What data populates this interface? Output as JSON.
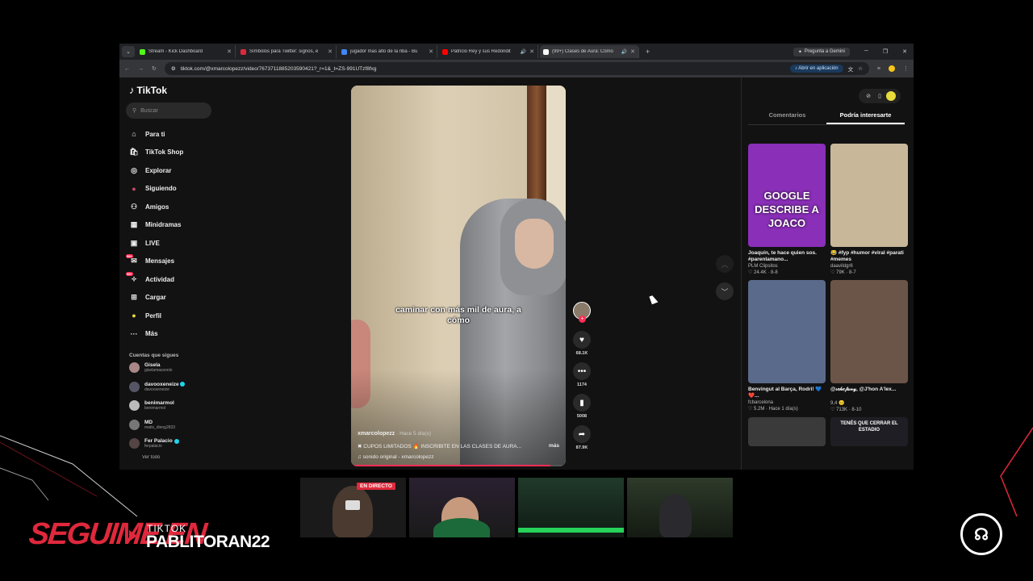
{
  "browser": {
    "tabs": [
      {
        "title": "Stream - Kick Dashboard",
        "fav_color": "#53fc18",
        "active": false,
        "audio": false
      },
      {
        "title": "Símbolos para Twitter: signos, e",
        "fav_color": "#e0283c",
        "active": false,
        "audio": false
      },
      {
        "title": "jugador mas alto de la nba - Bu",
        "fav_color": "#4285f4",
        "active": false,
        "audio": false
      },
      {
        "title": "Patricio Rey y sus Redondit",
        "fav_color": "#ff0000",
        "active": false,
        "audio": true
      },
      {
        "title": "(99+) Clases de Aura: Cómo",
        "fav_color": "#ffffff",
        "active": true,
        "audio": true
      }
    ],
    "new_tab": "+",
    "gemini_label": "Pregunta a Gemini",
    "url": "tiktok.com/@xmarcolopezz/video/7673711885203590421?_r=1&_t=ZS-991UTzf8fxg",
    "open_app_label": "Abrir en aplicación"
  },
  "tiktok": {
    "logo": "TikTok",
    "search_placeholder": "Buscar",
    "nav": [
      {
        "label": "Para ti",
        "icon": "home-icon"
      },
      {
        "label": "TikTok Shop",
        "icon": "shop-icon"
      },
      {
        "label": "Explorar",
        "icon": "compass-icon"
      },
      {
        "label": "Siguiendo",
        "icon": "following-icon"
      },
      {
        "label": "Amigos",
        "icon": "friends-icon"
      },
      {
        "label": "Minidramas",
        "icon": "minidramas-icon"
      },
      {
        "label": "LIVE",
        "icon": "live-icon"
      },
      {
        "label": "Mensajes",
        "icon": "messages-icon",
        "badge": "99+"
      },
      {
        "label": "Actividad",
        "icon": "activity-icon",
        "badge": "99+"
      },
      {
        "label": "Cargar",
        "icon": "upload-icon"
      },
      {
        "label": "Perfil",
        "icon": "profile-icon"
      },
      {
        "label": "Más",
        "icon": "more-icon"
      }
    ],
    "following_title": "Cuentas que sigues",
    "following": [
      {
        "name": "Gisela",
        "handle": "giselamassonlo",
        "verified": false
      },
      {
        "name": "davooxeneize",
        "handle": "davooxeneize",
        "verified": true
      },
      {
        "name": "benimarmol",
        "handle": "benimarmol",
        "verified": false
      },
      {
        "name": "MD",
        "handle": "matis_dieng2833",
        "verified": false
      },
      {
        "name": "Fer Palacio",
        "handle": "ferpalacio",
        "verified": true
      }
    ],
    "see_all": "Ver todo"
  },
  "video": {
    "caption": "caminar con más mil de aura, a cómo",
    "author": "xmarcolopezz",
    "time": "· Hace 5 día(s)",
    "description": "✖ CUPOS LIMITADOS 🔥 INSCRIBITE EN LAS CLASES DE AURA...",
    "more": "más",
    "sound": "♫  sonido original - xmarcolopezz",
    "progress": 0.93,
    "likes": "68.1K",
    "comments": "1174",
    "saves": "5008",
    "shares": "87.9K"
  },
  "right_panel": {
    "tabs": [
      "Comentarios",
      "Podría interesarte"
    ],
    "active_tab": 1,
    "cards": [
      {
        "title": "Joaquín, te hace quien sos. #parenlamano...",
        "author": "PLM Clipsitos",
        "stats": "♡ 24.4K · 8-8",
        "thumb_text": "GOOGLE DESCRIBE A JOACO",
        "bg": "#8a2fb8"
      },
      {
        "title": "😂 #fyp #humor #viral #parati #memes",
        "author": "daavildgr6",
        "stats": "♡ 79K · 8-7",
        "thumb_text": "",
        "bg": "#c9b79a"
      },
      {
        "title": "Benvingut al Barça, Rodri! 💙❤️...",
        "author": "fcbarcelona",
        "stats": "♡ 5.2M · Hace 1 día(s)",
        "thumb_text": "",
        "bg": "#5a6a8a"
      },
      {
        "title": "@𝓈𝑒𝒽𝑒𝒻𝒶𝓃𝓎, @J'hon A'lex...",
        "author": "9,4 😐",
        "stats": "♡ 713K · 8-10",
        "thumb_text": "",
        "bg": "#6a5548"
      },
      {
        "title": "",
        "author": "",
        "stats": "",
        "thumb_text": "",
        "bg": "#3a3a3a"
      },
      {
        "title": "",
        "author": "",
        "stats": "",
        "thumb_text": "TENÉS QUE CERRAR EL ESTADIO",
        "bg": "#1e1e24"
      }
    ]
  },
  "stream": {
    "live_tag": "EN DIRECTO",
    "follow_text": "SEGUIME EN",
    "platform": "TIKTOK",
    "handle": "PABLITORAN22",
    "accent": "#e0283c"
  }
}
